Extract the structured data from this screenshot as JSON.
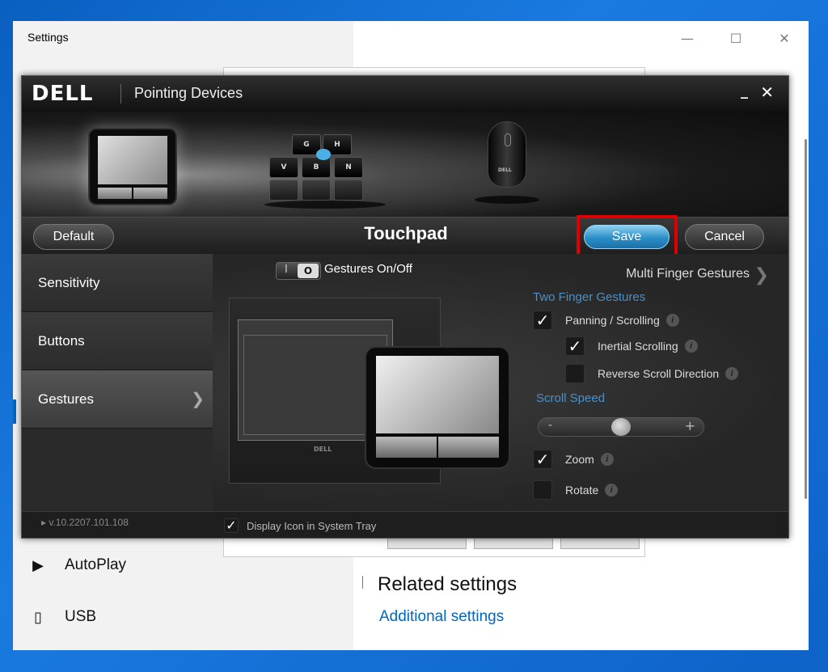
{
  "settings": {
    "title": "Settings",
    "nav": [
      {
        "label": "AutoPlay",
        "icon": "autoplay-icon"
      },
      {
        "label": "USB",
        "icon": "usb-icon"
      }
    ],
    "related_title": "Related settings",
    "related_link": "Additional settings"
  },
  "dell": {
    "logo": "DELL",
    "title": "Pointing Devices",
    "panel_title": "Touchpad",
    "buttons": {
      "default": "Default",
      "save": "Save",
      "cancel": "Cancel"
    },
    "devices": {
      "keys": [
        "G",
        "H",
        "V",
        "B",
        "N"
      ]
    },
    "left_nav": [
      {
        "label": "Sensitivity"
      },
      {
        "label": "Buttons"
      },
      {
        "label": "Gestures",
        "active": true
      }
    ],
    "gestures_toggle": {
      "off_label": "I",
      "on_label": "O",
      "label": "Gestures On/Off"
    },
    "multi_finger_link": "Multi Finger Gestures",
    "two_finger": {
      "header": "Two Finger Gestures",
      "options": [
        {
          "label": "Panning / Scrolling",
          "checked": true
        },
        {
          "label": "Inertial Scrolling",
          "checked": true
        },
        {
          "label": "Reverse Scroll Direction",
          "checked": false
        }
      ]
    },
    "scroll_speed": {
      "header": "Scroll Speed",
      "minus": "-",
      "plus": "+",
      "level": 0.5
    },
    "zoom": {
      "label": "Zoom",
      "checked": true
    },
    "rotate": {
      "label": "Rotate",
      "checked": false
    },
    "version": "v.10.2207.101.108",
    "tray_option": {
      "label": "Display Icon in System Tray",
      "checked": true
    },
    "demo_logo": "DELL",
    "mouse_logo": "DELL"
  },
  "colors": {
    "accent_blue": "#0067c0",
    "save_highlight": "#e00000",
    "section_header": "#4a90c8"
  }
}
